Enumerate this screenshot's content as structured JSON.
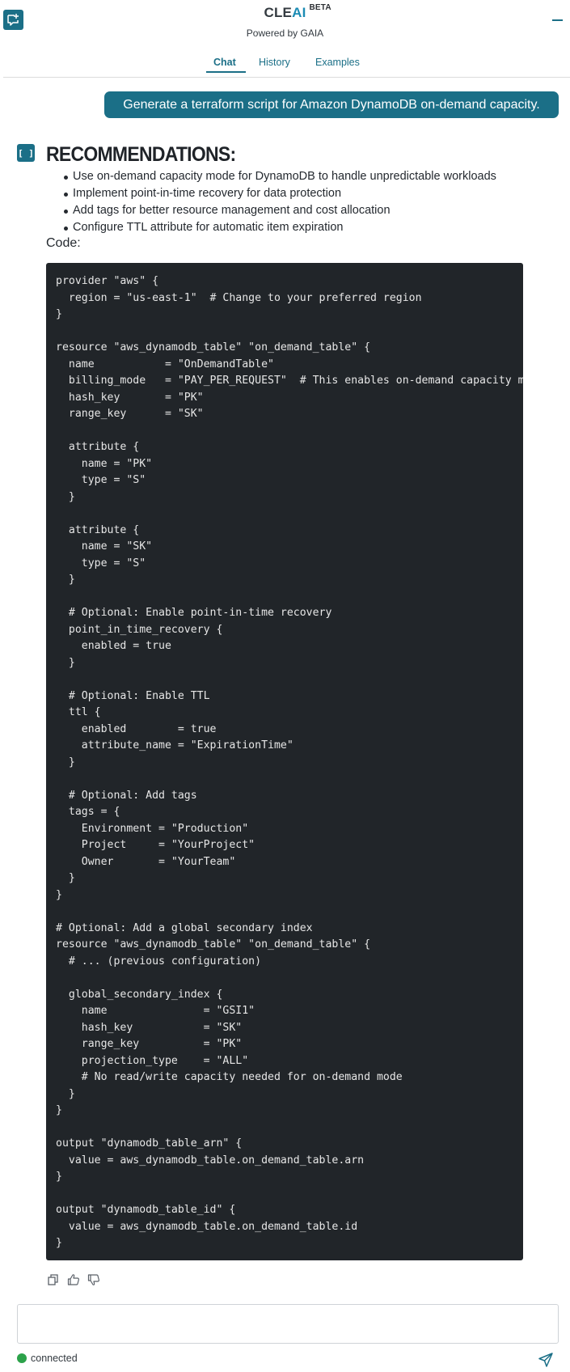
{
  "header": {
    "brand_prefix": "CLE",
    "brand_ai": "AI",
    "beta_label": "BETA",
    "powered_by": "Powered by GAIA"
  },
  "tabs": [
    {
      "label": "Chat",
      "active": true
    },
    {
      "label": "History",
      "active": false
    },
    {
      "label": "Examples",
      "active": false
    }
  ],
  "user_message": "Generate a terraform script for Amazon DynamoDB on-demand capacity.",
  "bot": {
    "icon_label": "[ ]",
    "heading": "RECOMMENDATIONS:",
    "recommendations": [
      "Use on-demand capacity mode for DynamoDB to handle unpredictable workloads",
      "Implement point-in-time recovery for data protection",
      "Add tags for better resource management and cost allocation",
      "Configure TTL attribute for automatic item expiration"
    ],
    "code_label": "Code:",
    "code": "provider \"aws\" {\n  region = \"us-east-1\"  # Change to your preferred region\n}\n\nresource \"aws_dynamodb_table\" \"on_demand_table\" {\n  name           = \"OnDemandTable\"\n  billing_mode   = \"PAY_PER_REQUEST\"  # This enables on-demand capacity mode\n  hash_key       = \"PK\"\n  range_key      = \"SK\"\n\n  attribute {\n    name = \"PK\"\n    type = \"S\"\n  }\n\n  attribute {\n    name = \"SK\"\n    type = \"S\"\n  }\n\n  # Optional: Enable point-in-time recovery\n  point_in_time_recovery {\n    enabled = true\n  }\n\n  # Optional: Enable TTL\n  ttl {\n    enabled        = true\n    attribute_name = \"ExpirationTime\"\n  }\n\n  # Optional: Add tags\n  tags = {\n    Environment = \"Production\"\n    Project     = \"YourProject\"\n    Owner       = \"YourTeam\"\n  }\n}\n\n# Optional: Add a global secondary index\nresource \"aws_dynamodb_table\" \"on_demand_table\" {\n  # ... (previous configuration)\n\n  global_secondary_index {\n    name               = \"GSI1\"\n    hash_key           = \"SK\"\n    range_key          = \"PK\"\n    projection_type    = \"ALL\"\n    # No read/write capacity needed for on-demand mode\n  }\n}\n\noutput \"dynamodb_table_arn\" {\n  value = aws_dynamodb_table.on_demand_table.arn\n}\n\noutput \"dynamodb_table_id\" {\n  value = aws_dynamodb_table.on_demand_table.id\n}"
  },
  "input": {
    "value": "",
    "placeholder": ""
  },
  "status": {
    "label": "connected",
    "color": "#2ca24a"
  },
  "colors": {
    "accent": "#1b6f87",
    "code_bg": "#212529"
  },
  "icons": {
    "new_chat": "new-chat-icon",
    "minimize": "minimize-icon",
    "copy": "copy-icon",
    "thumbs_up": "thumbs-up-icon",
    "thumbs_down": "thumbs-down-icon",
    "send": "send-icon"
  }
}
